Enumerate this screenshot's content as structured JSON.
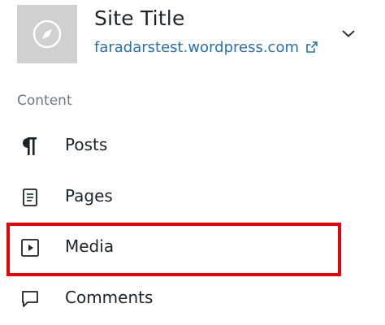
{
  "site": {
    "title": "Site Title",
    "url": "faradarstest.wordpress.com",
    "icon": "compass-icon",
    "url_icon": "external-link-icon",
    "switcher_icon": "chevron-down-icon"
  },
  "section": {
    "label": "Content"
  },
  "menu": {
    "items": [
      {
        "label": "Posts",
        "icon": "pilcrow-icon"
      },
      {
        "label": "Pages",
        "icon": "page-icon"
      },
      {
        "label": "Media",
        "icon": "media-icon",
        "highlighted": true
      },
      {
        "label": "Comments",
        "icon": "comment-icon"
      }
    ]
  },
  "colors": {
    "link": "#2271b1",
    "text": "#1d2327",
    "muted": "#6c7781",
    "highlight_border": "#e8000b",
    "site_icon_bg": "#d0d0d0"
  }
}
